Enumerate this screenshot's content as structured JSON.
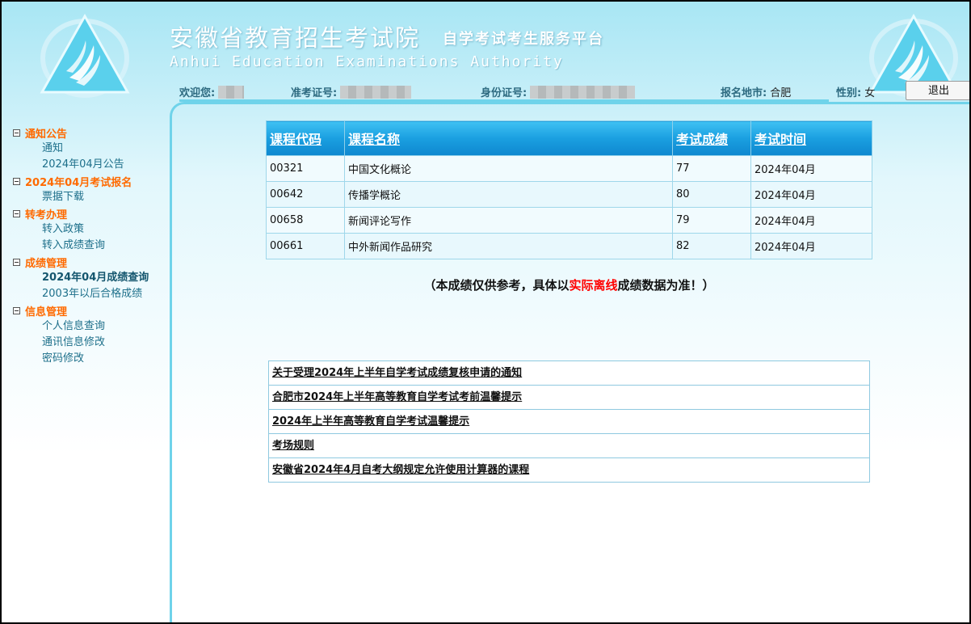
{
  "header": {
    "title": "安徽省教育招生考试院",
    "subtitle": "自学考试考生服务平台",
    "english": "Anhui Education Examinations Authority"
  },
  "info_bar": {
    "welcome_label": "欢迎您:",
    "exam_no_label": "准考证号:",
    "id_no_label": "身份证号:",
    "location_label": "报名地市:",
    "location_value": "合肥",
    "gender_label": "性别:",
    "gender_value": "女"
  },
  "logout_label": "退出",
  "sidebar": {
    "groups": [
      {
        "label": "通知公告",
        "items": [
          "通知",
          "2024年04月公告"
        ]
      },
      {
        "label": "2024年04月考试报名",
        "items": [
          "票据下载"
        ]
      },
      {
        "label": "转考办理",
        "items": [
          "转入政策",
          "转入成绩查询"
        ]
      },
      {
        "label": "成绩管理",
        "items": [
          "2024年04月成绩查询",
          "2003年以后合格成绩"
        ]
      },
      {
        "label": "信息管理",
        "items": [
          "个人信息查询",
          "通讯信息修改",
          "密码修改"
        ]
      }
    ]
  },
  "scores": {
    "headers": [
      "课程代码",
      "课程名称",
      "考试成绩",
      "考试时间"
    ],
    "rows": [
      [
        "00321",
        "中国文化概论",
        "77",
        "2024年04月"
      ],
      [
        "00642",
        "传播学概论",
        "80",
        "2024年04月"
      ],
      [
        "00658",
        "新闻评论写作",
        "79",
        "2024年04月"
      ],
      [
        "00661",
        "中外新闻作品研究",
        "82",
        "2024年04月"
      ]
    ]
  },
  "notice": {
    "prefix": "（本成绩仅供参考，具体以",
    "highlight": "实际离线",
    "suffix": "成绩数据为准！）"
  },
  "links": [
    "关于受理2024年上半年自学考试成绩复核申请的通知",
    "合肥市2024年上半年高等教育自学考试考前温馨提示",
    "2024年上半年高等教育自学考试温馨提示",
    "考场规则",
    "安徽省2024年4月自考大纲规定允许使用计算器的课程"
  ],
  "colors": {
    "accent_orange": "#ff6a00",
    "link_teal": "#1d6f8a",
    "table_header_blue": "#1a9fe0",
    "notice_red": "#ff0000"
  }
}
